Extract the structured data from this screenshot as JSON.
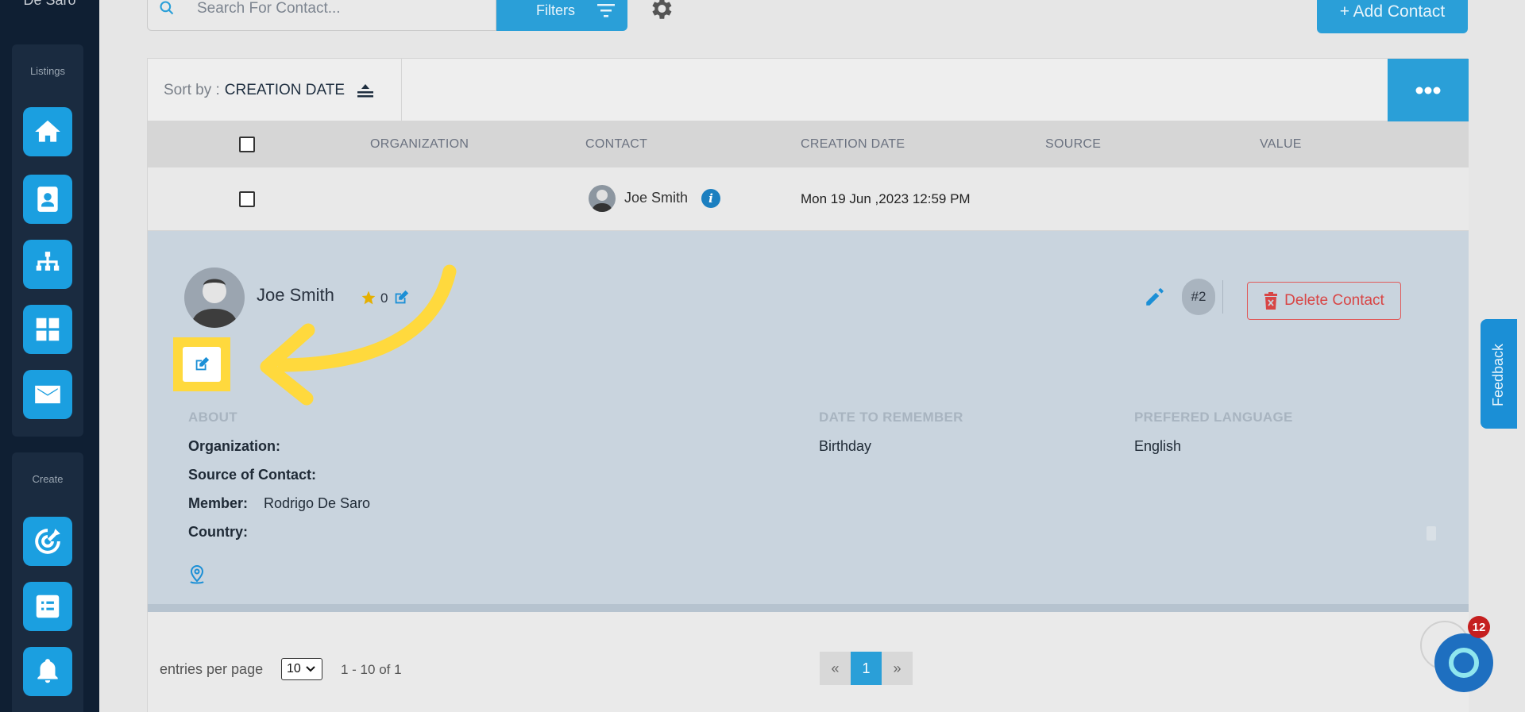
{
  "sidebar": {
    "brand": "De Saro",
    "groups": [
      {
        "title": "Listings",
        "items": [
          "home-icon",
          "contact-card-icon",
          "org-chart-icon",
          "grid-icon",
          "mail-icon"
        ]
      },
      {
        "title": "Create",
        "items": [
          "target-icon",
          "checklist-icon",
          "bell-icon"
        ]
      }
    ]
  },
  "toolbar": {
    "search_placeholder": "Search For Contact...",
    "filters_label": "Filters",
    "add_contact_label": "+ Add Contact"
  },
  "sortbar": {
    "prefix": "Sort by :",
    "field": "CREATION DATE"
  },
  "table": {
    "headers": [
      "ORGANIZATION",
      "CONTACT",
      "CREATION DATE",
      "SOURCE",
      "VALUE"
    ],
    "rows": [
      {
        "organization": "",
        "contact": "Joe Smith",
        "creation_date": "Mon 19 Jun ,2023 12:59 PM",
        "source": "",
        "value": ""
      }
    ]
  },
  "detail": {
    "name": "Joe Smith",
    "star_count": "0",
    "id_badge": "#2",
    "delete_label": "Delete Contact",
    "sections": {
      "about": "ABOUT",
      "date_to_remember": "DATE TO REMEMBER",
      "preferred_language": "PREFERED LANGUAGE"
    },
    "fields": {
      "organization_label": "Organization:",
      "source_label": "Source of Contact:",
      "member_label": "Member:",
      "member_value": "Rodrigo De Saro",
      "country_label": "Country:",
      "date_value": "Birthday",
      "language_value": "English"
    }
  },
  "footer": {
    "entries_label": "entries per page",
    "entries_value": "10",
    "range_text": "1 - 10 of 1",
    "pager": [
      "«",
      "1",
      "»"
    ]
  },
  "widgets": {
    "feedback_label": "Feedback",
    "chat_badge": "12"
  },
  "colors": {
    "accent": "#2a9fd8",
    "sidebar": "#0f1f33",
    "highlight": "#ffd93d",
    "danger": "#d84545"
  }
}
